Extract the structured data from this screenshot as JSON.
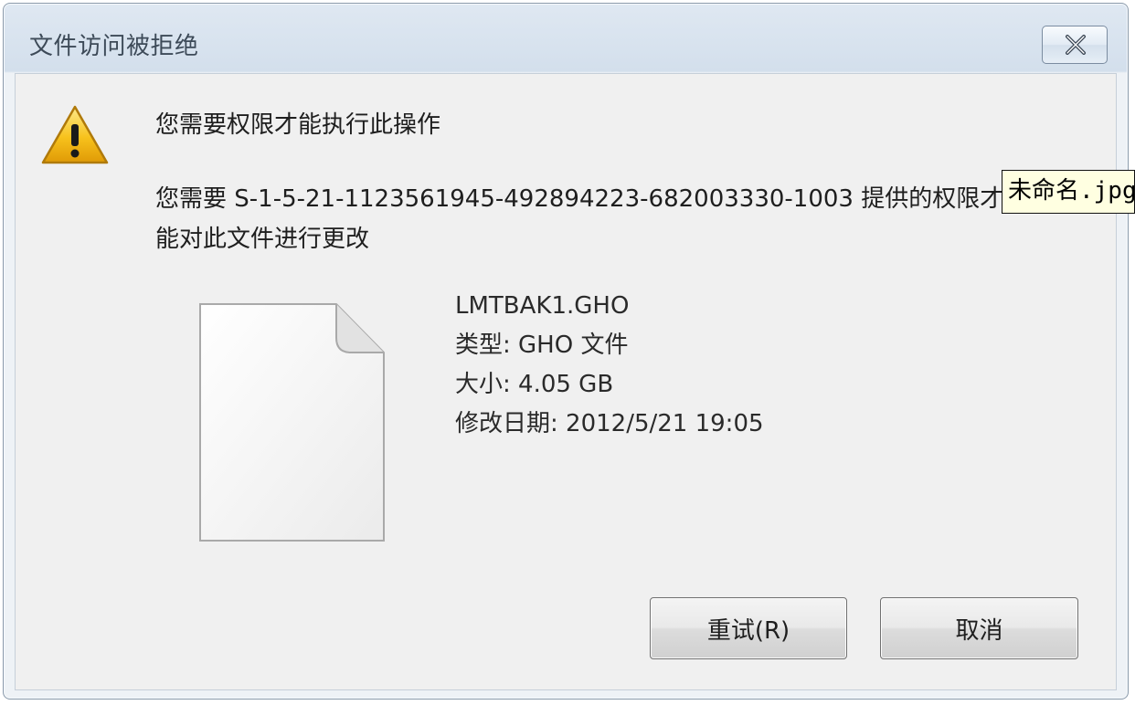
{
  "window": {
    "title": "文件访问被拒绝"
  },
  "main": {
    "heading": "您需要权限才能执行此操作",
    "message_line1": "您需要 S-1-5-21-1123561945-492894223-682003330-1003 提供的权限才",
    "message_line2": "能对此文件进行更改"
  },
  "tooltip": {
    "text": "未命名.jpg"
  },
  "file": {
    "name": "LMTBAK1.GHO",
    "type": "类型: GHO 文件",
    "size": "大小: 4.05 GB",
    "modified": "修改日期: 2012/5/21 19:05"
  },
  "buttons": {
    "retry": "重试(R)",
    "cancel": "取消"
  },
  "icons": {
    "warning": "warning-icon",
    "file": "file-icon",
    "close": "close-icon"
  },
  "colors": {
    "title_bar": "#d3dfec",
    "client_bg": "#f0f0f0",
    "warning_yellow": "#f7c21c",
    "tooltip_bg": "#ffffe1"
  }
}
